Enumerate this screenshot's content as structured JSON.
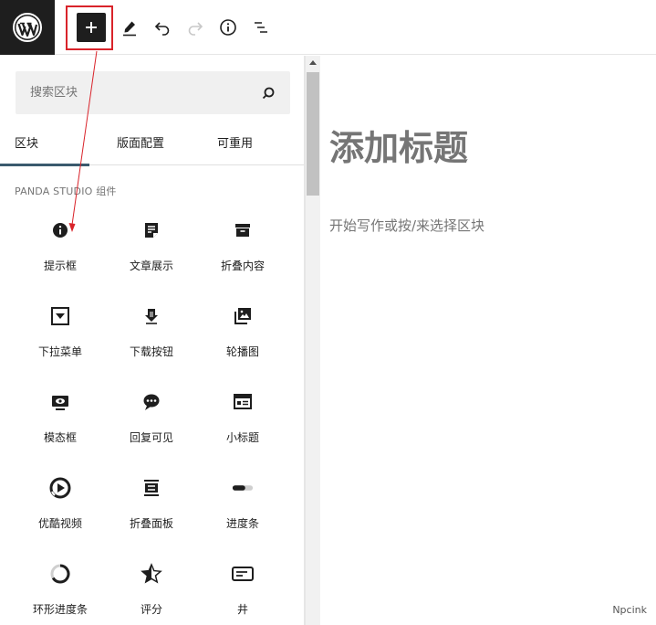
{
  "toolbar": {
    "logo_icon": "wordpress-logo",
    "inserter_icon": "plus-icon",
    "tools": [
      "pencil-icon",
      "undo-icon",
      "redo-icon",
      "info-icon",
      "list-view-icon"
    ]
  },
  "sidebar": {
    "search": {
      "placeholder": "搜索区块"
    },
    "tabs": [
      {
        "label": "区块",
        "active": true
      },
      {
        "label": "版面配置",
        "active": false
      },
      {
        "label": "可重用",
        "active": false
      }
    ],
    "section_title": "PANDA STUDIO 组件",
    "blocks": [
      {
        "label": "提示框",
        "icon": "info-circle-icon"
      },
      {
        "label": "文章展示",
        "icon": "post-document-icon"
      },
      {
        "label": "折叠内容",
        "icon": "archive-box-icon"
      },
      {
        "label": "下拉菜单",
        "icon": "dropdown-box-icon"
      },
      {
        "label": "下载按钮",
        "icon": "download-arrow-icon"
      },
      {
        "label": "轮播图",
        "icon": "gallery-images-icon"
      },
      {
        "label": "模态框",
        "icon": "modal-screen-icon"
      },
      {
        "label": "回复可见",
        "icon": "chat-bubble-icon"
      },
      {
        "label": "小标题",
        "icon": "heading-card-icon"
      },
      {
        "label": "优酷视频",
        "icon": "youku-play-icon"
      },
      {
        "label": "折叠面板",
        "icon": "accordion-panel-icon"
      },
      {
        "label": "进度条",
        "icon": "progress-bar-icon"
      },
      {
        "label": "环形进度条",
        "icon": "ring-progress-icon"
      },
      {
        "label": "评分",
        "icon": "half-star-icon"
      },
      {
        "label": "井",
        "icon": "card-lines-icon"
      }
    ]
  },
  "canvas": {
    "title_placeholder": "添加标题",
    "body_placeholder": "开始写作或按/来选择区块"
  },
  "watermark": "Npcink",
  "colors": {
    "dark": "#1e1e1e",
    "highlight": "#d9232a",
    "tab_indicator": "#3a5a6e",
    "placeholder": "#757575"
  }
}
